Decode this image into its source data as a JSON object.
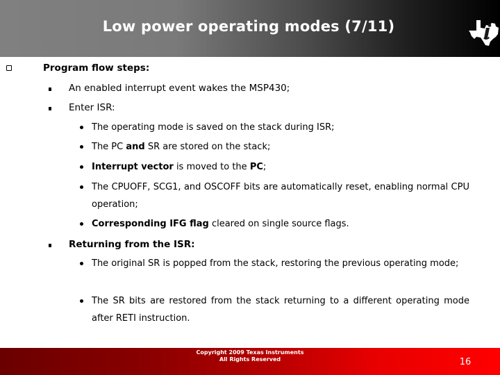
{
  "header": {
    "title": "Low power operating modes (7/11)",
    "logo_icon": "texas-instruments-logo-icon"
  },
  "body": {
    "heading": "Program flow steps:",
    "items": [
      {
        "text": "An enabled interrupt event wakes the MSP430;"
      },
      {
        "text": "Enter ISR:",
        "subitems": [
          {
            "parts": [
              {
                "text": "The operating mode is saved on the stack during ISR;",
                "bold": false
              }
            ]
          },
          {
            "parts": [
              {
                "text": "The PC ",
                "bold": false
              },
              {
                "text": "and",
                "bold": true
              },
              {
                "text": " SR are stored on the stack;",
                "bold": false
              }
            ]
          },
          {
            "parts": [
              {
                "text": "Interrupt vector",
                "bold": true
              },
              {
                "text": " is moved to the ",
                "bold": false
              },
              {
                "text": "PC",
                "bold": true
              },
              {
                "text": ";",
                "bold": false
              }
            ]
          },
          {
            "parts": [
              {
                "text": "The CPUOFF, SCG1, and OSCOFF bits are automatically reset, enabling normal CPU operation;",
                "bold": false
              }
            ]
          },
          {
            "parts": [
              {
                "text": "Corresponding IFG flag",
                "bold": true
              },
              {
                "text": " cleared on single source flags.",
                "bold": false
              }
            ]
          }
        ]
      },
      {
        "text": "Returning from the ISR:",
        "subitems": [
          {
            "parts": [
              {
                "text": "The original SR is popped from the stack, restoring the previous operating mode;",
                "bold": false
              }
            ]
          },
          {
            "parts": [
              {
                "text": "The SR bits are restored from the stack returning to a different operating mode after RETI instruction.",
                "bold": false
              }
            ]
          }
        ]
      }
    ]
  },
  "footer": {
    "copyright_line1": "Copyright  2009 Texas Instruments",
    "copyright_line2": "All Rights Reserved",
    "page_number": "16"
  },
  "colors": {
    "header_gradient_start": "#808080",
    "header_gradient_end": "#000000",
    "footer_gradient_start": "#6a0000",
    "footer_gradient_end": "#ff0000"
  }
}
